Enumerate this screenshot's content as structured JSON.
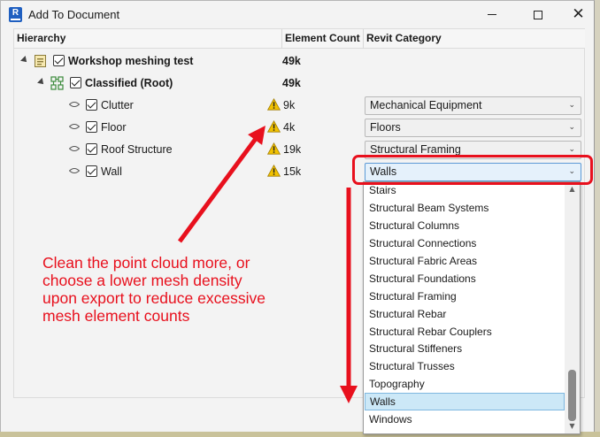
{
  "window": {
    "title": "Add To Document",
    "app_icon_letter": "R"
  },
  "columns": {
    "hierarchy": "Hierarchy",
    "element_count": "Element Count",
    "revit_category": "Revit Category"
  },
  "tree": [
    {
      "label": "Workshop meshing test",
      "count": "49k",
      "bold": true,
      "icon": "document-icon"
    },
    {
      "label": "Classified (Root)",
      "count": "49k",
      "bold": true,
      "icon": "classification-icon"
    },
    {
      "label": "Clutter",
      "count": "9k",
      "warning": true,
      "category": "Mechanical Equipment"
    },
    {
      "label": "Floor",
      "count": "4k",
      "warning": true,
      "category": "Floors"
    },
    {
      "label": "Roof Structure",
      "count": "19k",
      "warning": true,
      "category": "Structural Framing"
    },
    {
      "label": "Wall",
      "count": "15k",
      "warning": true,
      "category": "Walls"
    }
  ],
  "dropdown": {
    "items": [
      "Stairs",
      "Structural Beam Systems",
      "Structural Columns",
      "Structural Connections",
      "Structural Fabric Areas",
      "Structural Foundations",
      "Structural Framing",
      "Structural Rebar",
      "Structural Rebar Couplers",
      "Structural Stiffeners",
      "Structural Trusses",
      "Topography",
      "Walls",
      "Windows"
    ],
    "selected": "Walls"
  },
  "annotation": {
    "line1": "Clean the point cloud more, or",
    "line2": "choose a lower mesh density",
    "line3": "upon export to reduce excessive",
    "line4": "mesh element counts"
  },
  "colors": {
    "annotation_red": "#e8101d",
    "warning_yellow": "#f2c200",
    "selection_blue": "#cce8f7"
  }
}
